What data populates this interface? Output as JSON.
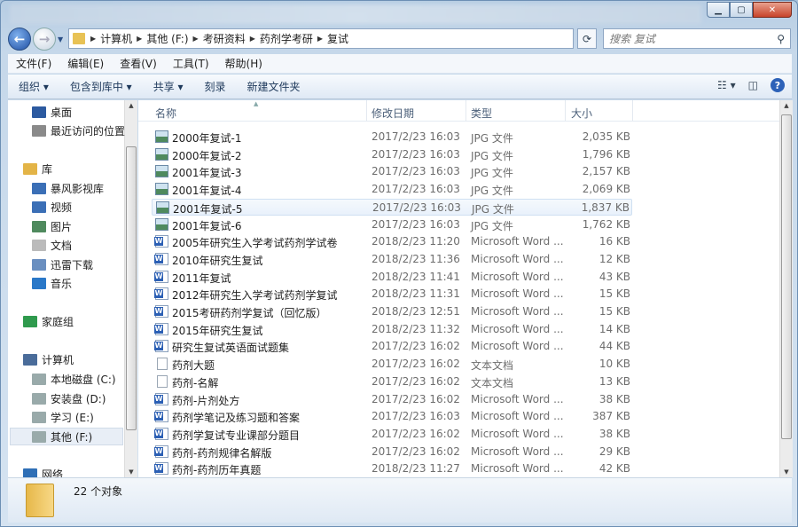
{
  "window": {
    "caption_buttons": [
      "minimize",
      "maximize",
      "close"
    ]
  },
  "address": {
    "crumbs": [
      "计算机",
      "其他 (F:)",
      "考研资料",
      "药剂学考研",
      "复试"
    ]
  },
  "search": {
    "placeholder": "搜索 复试"
  },
  "menu": [
    "文件(F)",
    "编辑(E)",
    "查看(V)",
    "工具(T)",
    "帮助(H)"
  ],
  "toolbar": {
    "organize": "组织 ▾",
    "include": "包含到库中 ▾",
    "share": "共享 ▾",
    "burn": "刻录",
    "new_folder": "新建文件夹"
  },
  "sidebar": {
    "items": [
      {
        "label": "桌面",
        "color": "#2c5aa0"
      },
      {
        "label": "最近访问的位置",
        "color": "#8a8a8a"
      },
      {
        "label": "库",
        "color": "#e3b447"
      },
      {
        "label": "暴风影视库",
        "color": "#3b6fb6"
      },
      {
        "label": "视频",
        "color": "#3b6fb6"
      },
      {
        "label": "图片",
        "color": "#4f8a5e"
      },
      {
        "label": "文档",
        "color": "#bbbbbb"
      },
      {
        "label": "迅雷下载",
        "color": "#6a8fc0"
      },
      {
        "label": "音乐",
        "color": "#2a78c8"
      },
      {
        "label": "家庭组",
        "color": "#2f9a4d"
      },
      {
        "label": "计算机",
        "color": "#4a6c9a"
      },
      {
        "label": "本地磁盘 (C:)",
        "color": "#9aa"
      },
      {
        "label": "安装盘 (D:)",
        "color": "#9aa"
      },
      {
        "label": "学习 (E:)",
        "color": "#9aa"
      },
      {
        "label": "其他 (F:)",
        "color": "#9aa"
      },
      {
        "label": "网络",
        "color": "#2f6fb6"
      }
    ]
  },
  "columns": {
    "name": "名称",
    "date": "修改日期",
    "type": "类型",
    "size": "大小"
  },
  "files": [
    {
      "name": "2000年复试-1",
      "date": "2017/2/23 16:03",
      "type": "JPG 文件",
      "size": "2,035 KB",
      "icon": "jpg"
    },
    {
      "name": "2000年复试-2",
      "date": "2017/2/23 16:03",
      "type": "JPG 文件",
      "size": "1,796 KB",
      "icon": "jpg"
    },
    {
      "name": "2001年复试-3",
      "date": "2017/2/23 16:03",
      "type": "JPG 文件",
      "size": "2,157 KB",
      "icon": "jpg"
    },
    {
      "name": "2001年复试-4",
      "date": "2017/2/23 16:03",
      "type": "JPG 文件",
      "size": "2,069 KB",
      "icon": "jpg"
    },
    {
      "name": "2001年复试-5",
      "date": "2017/2/23 16:03",
      "type": "JPG 文件",
      "size": "1,837 KB",
      "icon": "jpg",
      "hover": true
    },
    {
      "name": "2001年复试-6",
      "date": "2017/2/23 16:03",
      "type": "JPG 文件",
      "size": "1,762 KB",
      "icon": "jpg"
    },
    {
      "name": "2005年研究生入学考试药剂学试卷",
      "date": "2018/2/23 11:20",
      "type": "Microsoft Word ...",
      "size": "16 KB",
      "icon": "doc"
    },
    {
      "name": "2010年研究生复试",
      "date": "2018/2/23 11:36",
      "type": "Microsoft Word ...",
      "size": "12 KB",
      "icon": "doc"
    },
    {
      "name": "2011年复试",
      "date": "2018/2/23 11:41",
      "type": "Microsoft Word ...",
      "size": "43 KB",
      "icon": "doc"
    },
    {
      "name": "2012年研究生入学考试药剂学复试",
      "date": "2018/2/23 11:31",
      "type": "Microsoft Word ...",
      "size": "15 KB",
      "icon": "doc"
    },
    {
      "name": "2015考研药剂学复试（回忆版）",
      "date": "2018/2/23 12:51",
      "type": "Microsoft Word ...",
      "size": "15 KB",
      "icon": "doc"
    },
    {
      "name": "2015年研究生复试",
      "date": "2018/2/23 11:32",
      "type": "Microsoft Word ...",
      "size": "14 KB",
      "icon": "doc"
    },
    {
      "name": "研究生复试英语面试题集",
      "date": "2017/2/23 16:02",
      "type": "Microsoft Word ...",
      "size": "44 KB",
      "icon": "doc"
    },
    {
      "name": "药剂大题",
      "date": "2017/2/23 16:02",
      "type": "文本文档",
      "size": "10 KB",
      "icon": "txt"
    },
    {
      "name": "药剂-名解",
      "date": "2017/2/23 16:02",
      "type": "文本文档",
      "size": "13 KB",
      "icon": "txt"
    },
    {
      "name": "药剂-片剂处方",
      "date": "2017/2/23 16:02",
      "type": "Microsoft Word ...",
      "size": "38 KB",
      "icon": "doc"
    },
    {
      "name": "药剂学笔记及练习题和答案",
      "date": "2017/2/23 16:03",
      "type": "Microsoft Word ...",
      "size": "387 KB",
      "icon": "doc"
    },
    {
      "name": "药剂学复试专业课部分题目",
      "date": "2017/2/23 16:02",
      "type": "Microsoft Word ...",
      "size": "38 KB",
      "icon": "doc"
    },
    {
      "name": "药剂-药剂规律名解版",
      "date": "2017/2/23 16:02",
      "type": "Microsoft Word ...",
      "size": "29 KB",
      "icon": "doc"
    },
    {
      "name": "药剂-药剂历年真题",
      "date": "2018/2/23 11:27",
      "type": "Microsoft Word ...",
      "size": "42 KB",
      "icon": "doc"
    }
  ],
  "status": {
    "count": "22 个对象"
  }
}
